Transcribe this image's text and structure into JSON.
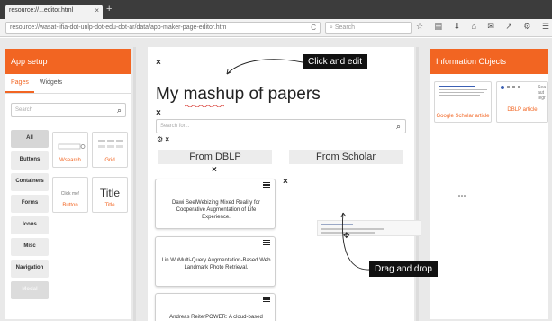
{
  "browser": {
    "tab_title": "resource://...editor.html",
    "tab_close": "×",
    "new_tab": "+",
    "url": "resource://wasat-lifia-dot-unlp-dot-edu-dot-ar/data/app-maker-page-editor.htm",
    "reload": "C",
    "search_placeholder": "Search",
    "toolbar_icons": [
      "☆",
      "▤",
      "⬇",
      "⌂",
      "✉",
      "↗",
      "⚙",
      "☰"
    ]
  },
  "app_setup": {
    "title": "App setup",
    "tabs": [
      "Pages",
      "Widgets"
    ],
    "search_placeholder": "Search",
    "categories": [
      "All",
      "Buttons",
      "Containers",
      "Forms",
      "Icons",
      "Misc",
      "Navigation",
      "Modal"
    ],
    "widgets": [
      {
        "label": "Wsearch",
        "preview": ""
      },
      {
        "label": "Grid",
        "preview": ""
      },
      {
        "label": "Button",
        "preview": "Click me!"
      },
      {
        "label": "Title",
        "preview": "Title"
      }
    ]
  },
  "editor": {
    "page_title": "My mashup of papers",
    "close_glyph": "×",
    "search_placeholder": "Search for...",
    "gear_glyph": "⚙ ×",
    "columns": [
      "From DBLP",
      "From Scholar"
    ],
    "cards": [
      "Dawi SeelWebizing Mixed Reality for Cooperative Augmentation of Life Experience.",
      "Lin WuMulti-Query Augmentation-Based Web Landmark Photo Retrieval.",
      "Andreas ReiterPOWER: A cloud-based"
    ]
  },
  "info_objects": {
    "title": "Information Objects",
    "items": [
      {
        "label": "Google Scholar article"
      },
      {
        "label": "DBLP article",
        "extra": [
          "Sea",
          "aut",
          "tegr"
        ]
      }
    ]
  },
  "callouts": {
    "click_edit": "Click and edit",
    "drag_drop": "Drag and drop"
  },
  "colors": {
    "accent": "#f26522",
    "callout_bg": "#111111",
    "scholar_link": "#3b5fb3"
  }
}
